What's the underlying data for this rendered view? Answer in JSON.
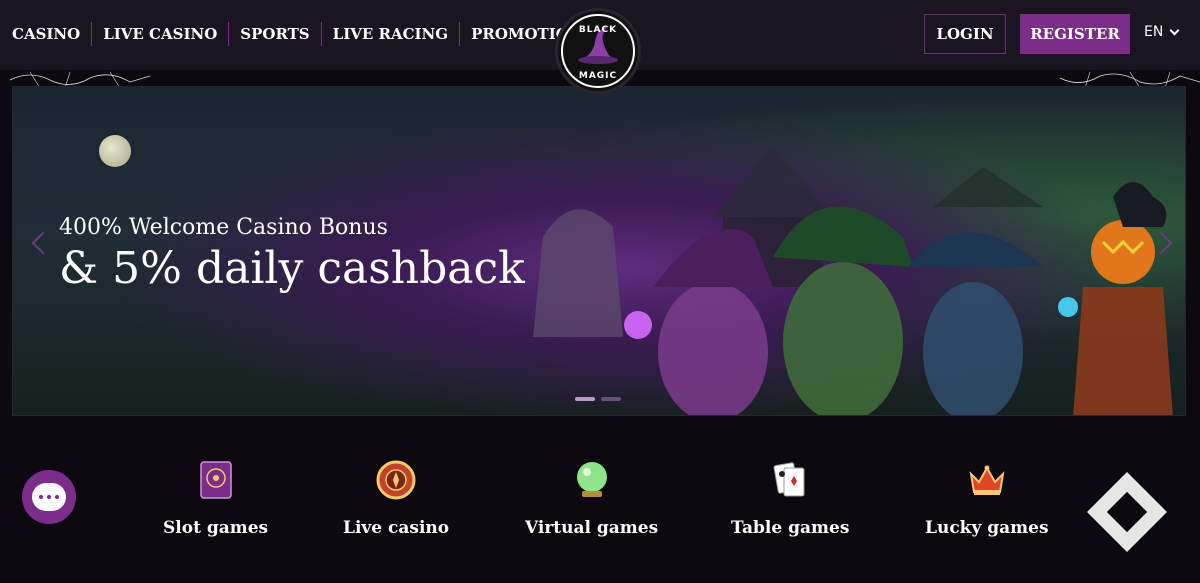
{
  "nav": {
    "items": [
      {
        "label": "CASINO"
      },
      {
        "label": "LIVE CASINO"
      },
      {
        "label": "SPORTS"
      },
      {
        "label": "LIVE RACING"
      },
      {
        "label": "PROMOTIONS"
      }
    ]
  },
  "logo": {
    "top_word": "BLACK",
    "bottom_word": "MAGIC"
  },
  "header": {
    "login_label": "LOGIN",
    "register_label": "REGISTER",
    "language": "EN"
  },
  "banner": {
    "subtitle": "400% Welcome Casino Bonus",
    "title": "& 5% daily cashback",
    "slide_count": 2,
    "active_slide": 1
  },
  "categories": [
    {
      "label": "Slot games",
      "icon": "slot-book-icon"
    },
    {
      "label": "Live casino",
      "icon": "roulette-chip-icon"
    },
    {
      "label": "Virtual games",
      "icon": "crystal-ball-icon"
    },
    {
      "label": "Table games",
      "icon": "playing-cards-icon"
    },
    {
      "label": "Lucky games",
      "icon": "crown-icon"
    }
  ],
  "colors": {
    "header_bg": "#1a1521",
    "accent_purple": "#7a2e8a",
    "page_bg": "#0c0a10"
  }
}
